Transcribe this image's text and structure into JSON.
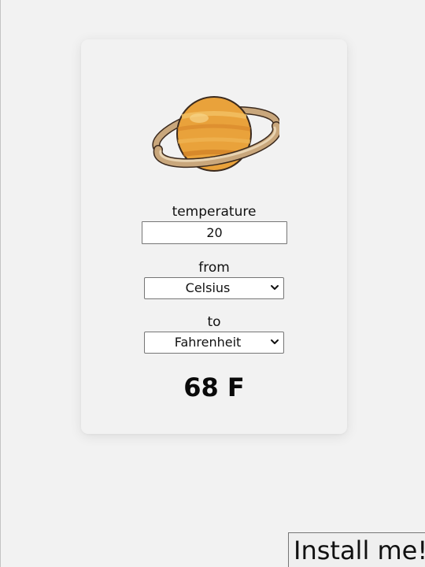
{
  "converter": {
    "icon": "saturn-planet-icon",
    "temperature_label": "temperature",
    "temperature_value": "20",
    "from_label": "from",
    "from_selected": "Celsius",
    "to_label": "to",
    "to_selected": "Fahrenheit",
    "result": "68 F"
  },
  "install_button_label": "Install me!",
  "colors": {
    "page_background": "#f2f2f2",
    "planet_body": "#e9a23b",
    "planet_ring": "#c9a77c",
    "planet_outline": "#3b2a1e"
  }
}
